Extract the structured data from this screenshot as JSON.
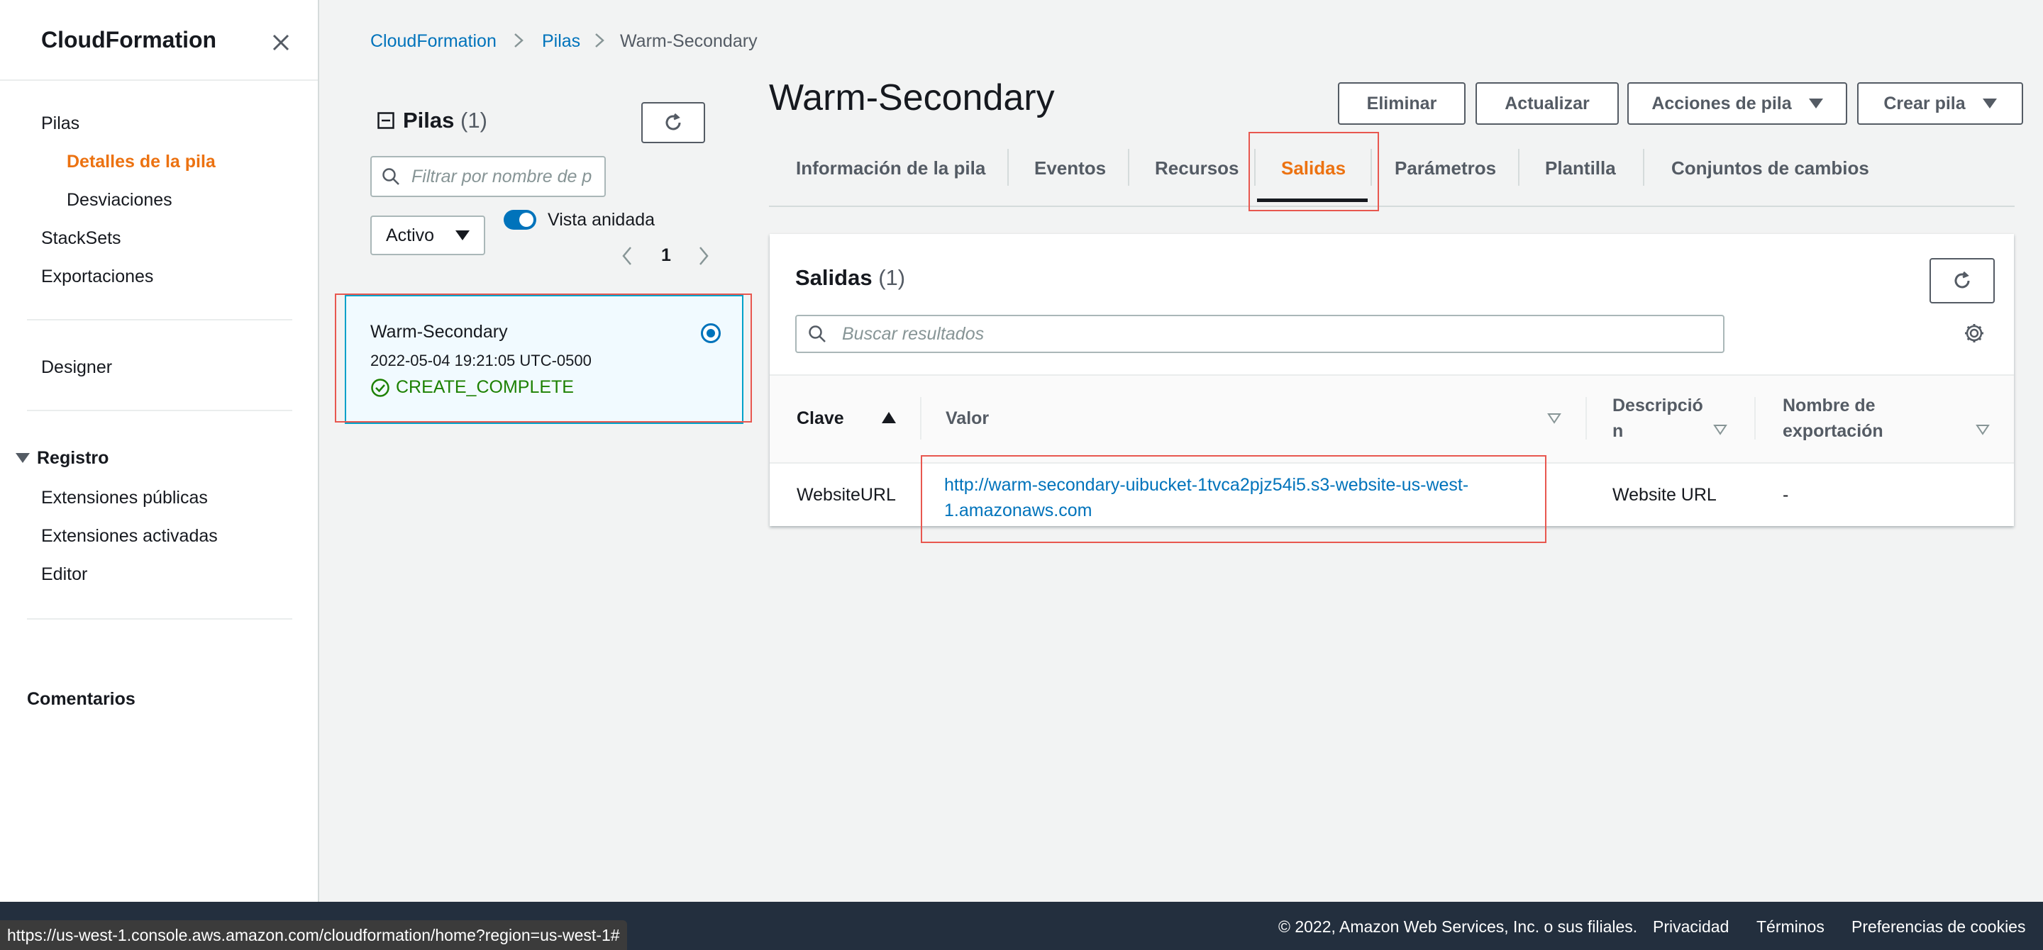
{
  "sidebar": {
    "title": "CloudFormation",
    "items": [
      {
        "label": "Pilas"
      },
      {
        "label": "Detalles de la pila"
      },
      {
        "label": "Desviaciones"
      },
      {
        "label": "StackSets"
      },
      {
        "label": "Exportaciones"
      },
      {
        "label": "Designer"
      },
      {
        "label": "Extensiones públicas"
      },
      {
        "label": "Extensiones activadas"
      },
      {
        "label": "Editor"
      }
    ],
    "section_registro": "Registro",
    "comentarios": "Comentarios"
  },
  "breadcrumb": [
    "CloudFormation",
    "Pilas",
    "Warm-Secondary"
  ],
  "stacks_panel": {
    "title": "Pilas",
    "count": "(1)",
    "filter_placeholder": "Filtrar por nombre de p",
    "status_select": "Activo",
    "nested_view_label": "Vista anidada",
    "page": "1",
    "stack": {
      "name": "Warm-Secondary",
      "date": "2022-05-04 19:21:05 UTC-0500",
      "status": "CREATE_COMPLETE"
    }
  },
  "stack_detail": {
    "title": "Warm-Secondary",
    "buttons": {
      "delete": "Eliminar",
      "update": "Actualizar",
      "actions": "Acciones de pila",
      "create": "Crear pila"
    },
    "tabs": [
      {
        "label": "Información de la pila"
      },
      {
        "label": "Eventos"
      },
      {
        "label": "Recursos"
      },
      {
        "label": "Salidas"
      },
      {
        "label": "Parámetros"
      },
      {
        "label": "Plantilla"
      },
      {
        "label": "Conjuntos de cambios"
      }
    ]
  },
  "outputs": {
    "title": "Salidas",
    "count": "(1)",
    "search_placeholder": "Buscar resultados",
    "columns": {
      "key": "Clave",
      "value": "Valor",
      "description_1": "Descripció",
      "description_2": "n",
      "export_1": "Nombre de",
      "export_2": "exportación"
    },
    "rows": [
      {
        "key": "WebsiteURL",
        "value_1": "http://warm-secondary-uibucket-1tvca2pjz54i5.s3-website-us-west-",
        "value_2": "1.amazonaws.com",
        "description": "Website URL",
        "export": "-"
      }
    ]
  },
  "footer": {
    "copyright": "© 2022, Amazon Web Services, Inc. o sus filiales.",
    "privacy": "Privacidad",
    "terms": "Términos",
    "cookies": "Preferencias de cookies"
  },
  "status_url": "https://us-west-1.console.aws.amazon.com/cloudformation/home?region=us-west-1#",
  "colors": {
    "accent": "#ec7211",
    "link": "#0073bb",
    "success": "#1d8102",
    "highlight": "#e8574f"
  }
}
